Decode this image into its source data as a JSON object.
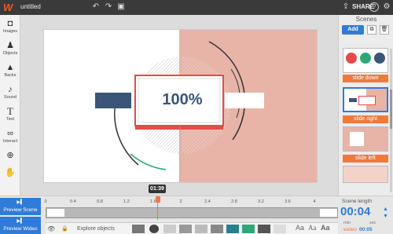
{
  "app": {
    "title": "untitled",
    "share_label": "SHARE",
    "help": "?"
  },
  "tools": [
    {
      "label": "Images"
    },
    {
      "label": "Objects"
    },
    {
      "label": "Backs"
    },
    {
      "label": "Sound"
    },
    {
      "label": "Text"
    },
    {
      "label": "Interact"
    },
    {
      "label": "Scenes"
    }
  ],
  "canvas": {
    "percent_text": "100%"
  },
  "scenes_panel": {
    "title": "Scenes",
    "add_label": "Add",
    "items": [
      {
        "label": "slide down"
      },
      {
        "label": "slide right"
      },
      {
        "label": "slide left"
      }
    ]
  },
  "bottom": {
    "preview_scene": "Preview Scene",
    "preview_wideo": "Preview Wideo",
    "time_bubble": "01:39",
    "ruler_ticks": [
      "0",
      "0.4",
      "0.8",
      "1.2",
      "1.6",
      "2",
      "2.4",
      "2.8",
      "3.2",
      "3.6",
      "4"
    ],
    "explore_label": "Explore objects",
    "aa_labels": [
      "Aa",
      "Aa",
      "Aa"
    ],
    "scene_length_label": "Scene length",
    "scene_time": "00:04",
    "min_label": "min",
    "sec_label": "sec",
    "wideo_label": "wideo",
    "wideo_time": "00:05"
  },
  "colors": {
    "accent_blue": "#2f7bd8",
    "accent_orange": "#f0793c",
    "scene_pink": "#e8b4a8",
    "frame_red": "#e64a4a",
    "navy_block": "#3a5577"
  }
}
